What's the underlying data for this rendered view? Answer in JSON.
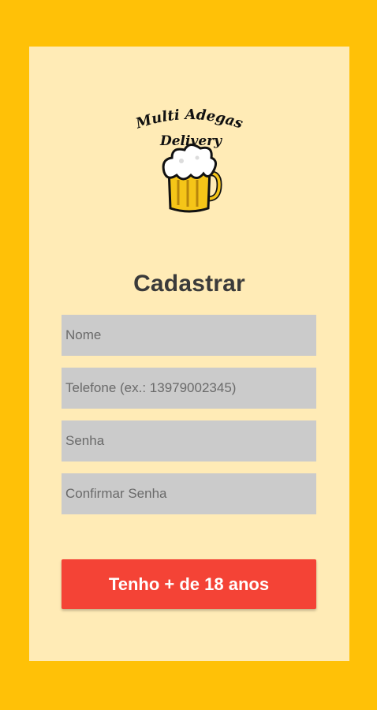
{
  "logo": {
    "line1": "Multi Adegas",
    "line2": "Delivery",
    "icon": "beer-mug-icon"
  },
  "form": {
    "title": "Cadastrar",
    "name_placeholder": "Nome",
    "phone_placeholder": "Telefone (ex.: 13979002345)",
    "password_placeholder": "Senha",
    "confirm_password_placeholder": "Confirmar Senha",
    "submit_label": "Tenho + de 18 anos"
  },
  "colors": {
    "background": "#FFC107",
    "card": "#FFEBB6",
    "field": "#CBCBCB",
    "button": "#F44336"
  }
}
